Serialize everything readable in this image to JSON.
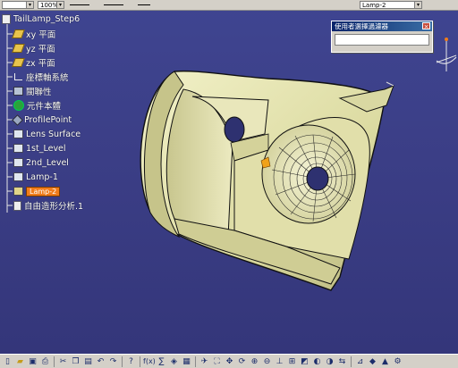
{
  "toolbar": {
    "zoom_value": "100%",
    "current_part": "Lamp-2"
  },
  "spec_tree": {
    "root": "TailLamp_Step6",
    "items": [
      {
        "label": "xy 平面",
        "icon": "plane-icon"
      },
      {
        "label": "yz 平面",
        "icon": "plane-icon"
      },
      {
        "label": "zx 平面",
        "icon": "plane-icon"
      },
      {
        "label": "座標軸系統",
        "icon": "axis-system-icon"
      },
      {
        "label": "關聯性",
        "icon": "relations-icon"
      },
      {
        "label": "元件本體",
        "icon": "part-body-icon"
      },
      {
        "label": "ProfilePoint",
        "icon": "point-icon"
      },
      {
        "label": "Lens Surface",
        "icon": "geometrical-set-icon"
      },
      {
        "label": "1st_Level",
        "icon": "geometrical-set-icon"
      },
      {
        "label": "2nd_Level",
        "icon": "geometrical-set-icon"
      },
      {
        "label": "Lamp-1",
        "icon": "geometrical-set-icon"
      },
      {
        "label": "Lamp-2",
        "icon": "geometrical-set-icon",
        "selected": true
      },
      {
        "label": "自由造形分析.1",
        "icon": "analysis-icon"
      }
    ]
  },
  "dialog": {
    "title": "使用者選擇過濾器",
    "close_label": "×"
  },
  "colors": {
    "background": "#3d3f86",
    "model_fill": "#e8e7b4",
    "selected": "#f07c1a",
    "toolbar": "#d4d0c8"
  },
  "bottom_toolbar": {
    "icons": [
      "new-icon",
      "open-icon",
      "save-icon",
      "print-icon",
      "cut-icon",
      "copy-icon",
      "paste-icon",
      "undo-icon",
      "redo-icon",
      "whats-this-icon",
      "formula-icon",
      "fx-icon",
      "knowledge-icon",
      "catalog-icon",
      "fly-mode-icon",
      "fit-all-icon",
      "pan-icon",
      "rotate-icon",
      "zoom-in-icon",
      "zoom-out-icon",
      "normal-view-icon",
      "multi-view-icon",
      "iso-view-icon",
      "shading-icon",
      "hide-show-icon",
      "swap-space-icon",
      "measure-icon",
      "apply-material-icon",
      "analysis-icon",
      "settings-icon"
    ]
  }
}
